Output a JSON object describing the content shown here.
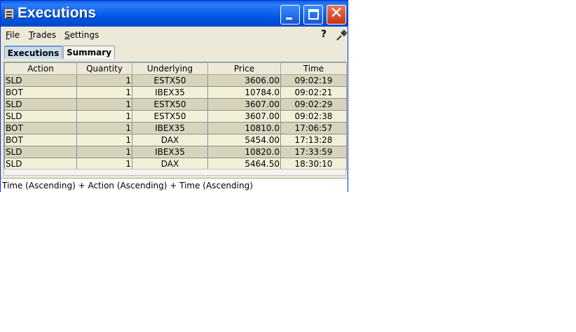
{
  "window": {
    "title": "Executions"
  },
  "menu": {
    "file": "File",
    "trades": "Trades",
    "settings": "Settings",
    "help": "?"
  },
  "tabs": [
    {
      "label": "Executions",
      "active": true
    },
    {
      "label": "Summary",
      "active": false
    }
  ],
  "table": {
    "columns": [
      "Action",
      "Quantity",
      "Underlying",
      "Price",
      "Time"
    ],
    "rows": [
      [
        "SLD",
        "1",
        "ESTX50",
        "3606.00",
        "09:02:19"
      ],
      [
        "BOT",
        "1",
        "IBEX35",
        "10784.0",
        "09:02:21"
      ],
      [
        "SLD",
        "1",
        "ESTX50",
        "3607.00",
        "09:02:29"
      ],
      [
        "SLD",
        "1",
        "ESTX50",
        "3607.00",
        "09:02:38"
      ],
      [
        "BOT",
        "1",
        "IBEX35",
        "10810.0",
        "17:06:57"
      ],
      [
        "BOT",
        "1",
        "DAX",
        "5454.00",
        "17:13:28"
      ],
      [
        "SLD",
        "1",
        "IBEX35",
        "10820.0",
        "17:33:59"
      ],
      [
        "SLD",
        "1",
        "DAX",
        "5464.50",
        "18:30:10"
      ]
    ]
  },
  "status": {
    "sort_text": "Time (Ascending)  +  Action (Ascending)  +  Time (Ascending)"
  },
  "colors": {
    "titlebar": "#0058e6",
    "row_odd": "#d8d4bb",
    "row_even": "#f3f0da",
    "close_button": "#c83312"
  }
}
